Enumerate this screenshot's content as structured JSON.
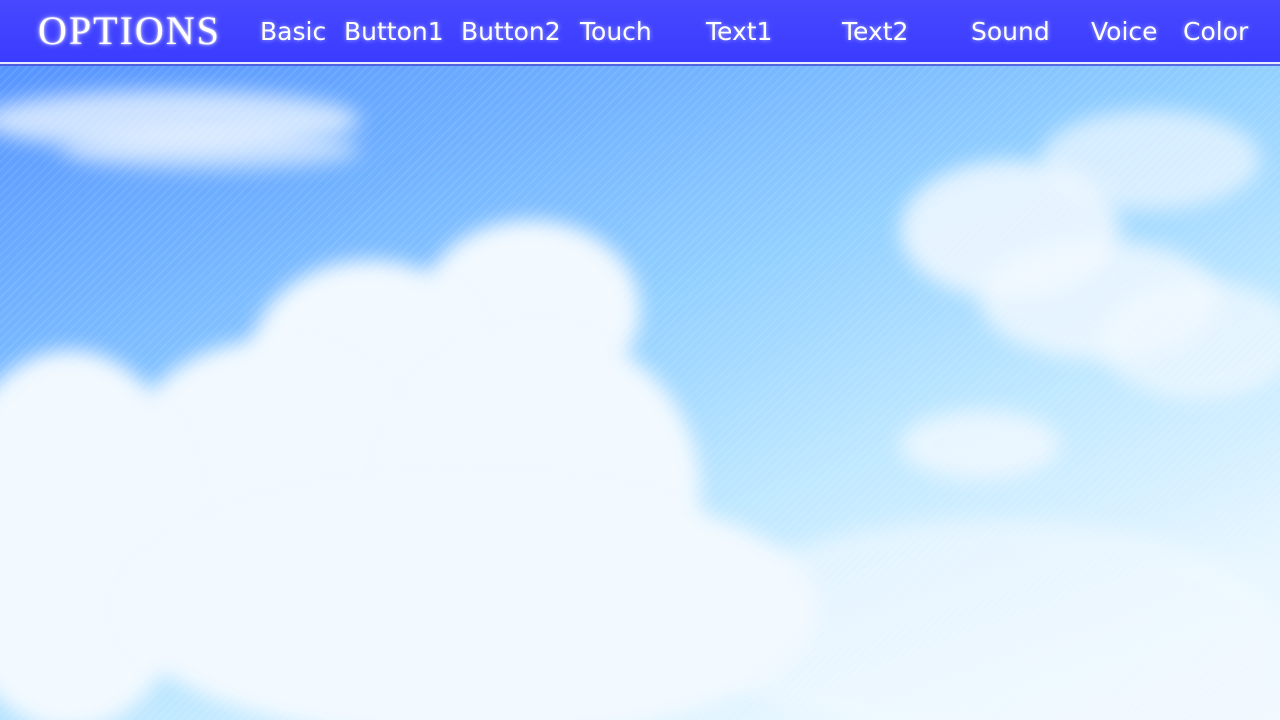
{
  "header": {
    "title": "OPTIONS",
    "bar_color": "#3f40ff",
    "tabs": [
      {
        "label": "Basic"
      },
      {
        "label": "Button1"
      },
      {
        "label": "Button2"
      },
      {
        "label": "Touch"
      },
      {
        "label": "Text1"
      },
      {
        "label": "Text2"
      },
      {
        "label": "Sound"
      },
      {
        "label": "Voice"
      },
      {
        "label": "Color"
      }
    ]
  },
  "background": {
    "scene": "sky-with-clouds",
    "sky_color": "#6fb0ff",
    "cloud_color": "#f2f9ff"
  }
}
